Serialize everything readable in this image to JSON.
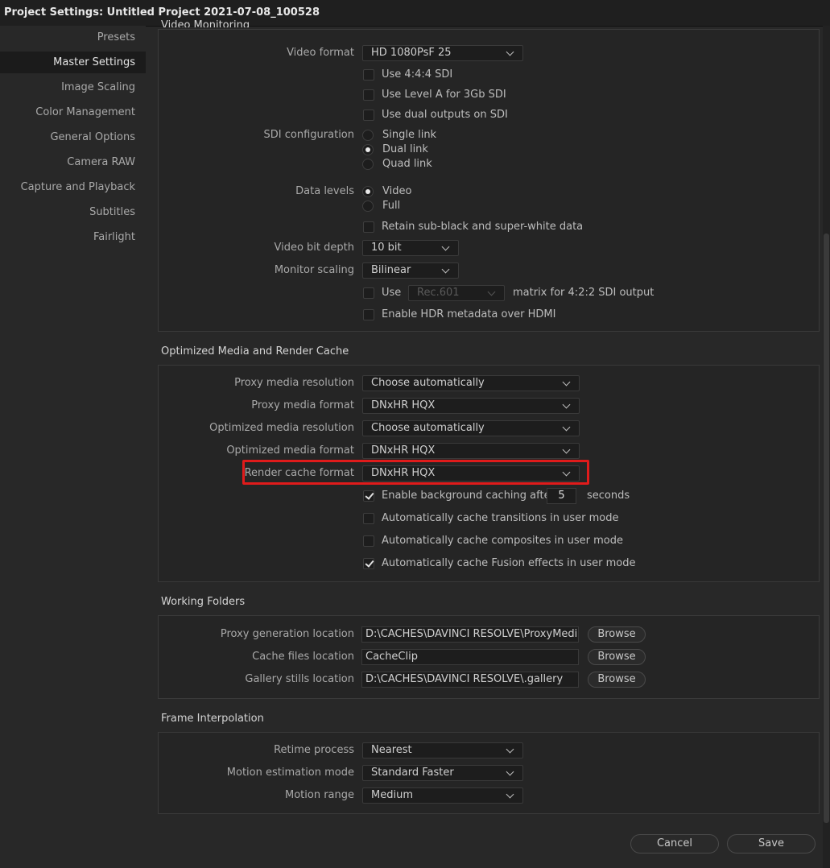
{
  "window": {
    "title": "Project Settings:  Untitled Project 2021-07-08_100528"
  },
  "sidebar": {
    "items": [
      {
        "label": "Presets",
        "active": false
      },
      {
        "label": "Master Settings",
        "active": true
      },
      {
        "label": "Image Scaling",
        "active": false
      },
      {
        "label": "Color Management",
        "active": false
      },
      {
        "label": "General Options",
        "active": false
      },
      {
        "label": "Camera RAW",
        "active": false
      },
      {
        "label": "Capture and Playback",
        "active": false
      },
      {
        "label": "Subtitles",
        "active": false
      },
      {
        "label": "Fairlight",
        "active": false
      }
    ]
  },
  "video_monitoring": {
    "header": "Video Monitoring",
    "video_format_label": "Video format",
    "video_format_value": "HD 1080PsF 25",
    "use_444_sdi": "Use 4:4:4 SDI",
    "use_level_a": "Use Level A for 3Gb SDI",
    "use_dual_outputs": "Use dual outputs on SDI",
    "sdi_config_label": "SDI configuration",
    "sdi_single": "Single link",
    "sdi_dual": "Dual link",
    "sdi_quad": "Quad link",
    "data_levels_label": "Data levels",
    "data_video": "Video",
    "data_full": "Full",
    "retain_subblack": "Retain sub-black and super-white data",
    "bit_depth_label": "Video bit depth",
    "bit_depth_value": "10 bit",
    "monitor_scaling_label": "Monitor scaling",
    "monitor_scaling_value": "Bilinear",
    "use_label": "Use",
    "matrix_value": "Rec.601",
    "matrix_suffix": "matrix for 4:2:2 SDI output",
    "enable_hdr": "Enable HDR metadata over HDMI"
  },
  "optimized_media": {
    "title": "Optimized Media and Render Cache",
    "proxy_res_label": "Proxy media resolution",
    "proxy_res_value": "Choose automatically",
    "proxy_fmt_label": "Proxy media format",
    "proxy_fmt_value": "DNxHR HQX",
    "opt_res_label": "Optimized media resolution",
    "opt_res_value": "Choose automatically",
    "opt_fmt_label": "Optimized media format",
    "opt_fmt_value": "DNxHR HQX",
    "render_cache_label": "Render cache format",
    "render_cache_value": "DNxHR HQX",
    "bg_caching_label": "Enable background caching after",
    "bg_caching_seconds": "5",
    "seconds_label": "seconds",
    "cache_transitions": "Automatically cache transitions in user mode",
    "cache_composites": "Automatically cache composites in user mode",
    "cache_fusion": "Automatically cache Fusion effects in user mode"
  },
  "working_folders": {
    "title": "Working Folders",
    "proxy_loc_label": "Proxy generation location",
    "proxy_loc_value": "D:\\CACHES\\DAVINCI RESOLVE\\ProxyMedia",
    "cache_loc_label": "Cache files location",
    "cache_loc_value": "CacheClip",
    "gallery_loc_label": "Gallery stills location",
    "gallery_loc_value": "D:\\CACHES\\DAVINCI RESOLVE\\.gallery",
    "browse_label": "Browse"
  },
  "frame_interpolation": {
    "title": "Frame Interpolation",
    "retime_label": "Retime process",
    "retime_value": "Nearest",
    "motion_mode_label": "Motion estimation mode",
    "motion_mode_value": "Standard Faster",
    "motion_range_label": "Motion range",
    "motion_range_value": "Medium"
  },
  "footer": {
    "cancel_label": "Cancel",
    "save_label": "Save"
  },
  "colors": {
    "highlight": "#e01b1b",
    "background": "#282828"
  }
}
